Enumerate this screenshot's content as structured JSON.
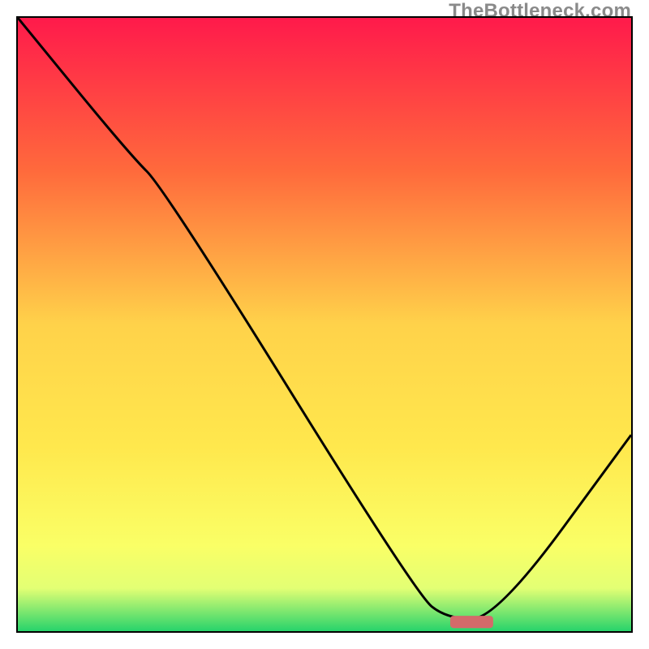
{
  "watermark": "TheBottleneck.com",
  "chart_data": {
    "type": "line",
    "title": "",
    "xlabel": "",
    "ylabel": "",
    "xlim": [
      0,
      100
    ],
    "ylim": [
      0,
      100
    ],
    "gradient_stops": [
      {
        "offset": 0,
        "color": "#ff1a4b"
      },
      {
        "offset": 25,
        "color": "#ff6a3c"
      },
      {
        "offset": 50,
        "color": "#ffd24a"
      },
      {
        "offset": 70,
        "color": "#ffe84d"
      },
      {
        "offset": 86,
        "color": "#faff66"
      },
      {
        "offset": 93,
        "color": "#e3ff74"
      },
      {
        "offset": 100,
        "color": "#27d36b"
      }
    ],
    "curve": [
      {
        "x": 0,
        "y": 100
      },
      {
        "x": 18,
        "y": 78
      },
      {
        "x": 24,
        "y": 72
      },
      {
        "x": 65,
        "y": 6
      },
      {
        "x": 70,
        "y": 2
      },
      {
        "x": 78,
        "y": 2
      },
      {
        "x": 100,
        "y": 32
      }
    ],
    "marker": {
      "x": 74,
      "y": 1.5,
      "w": 7,
      "h": 2,
      "color": "#d46a6a"
    }
  }
}
